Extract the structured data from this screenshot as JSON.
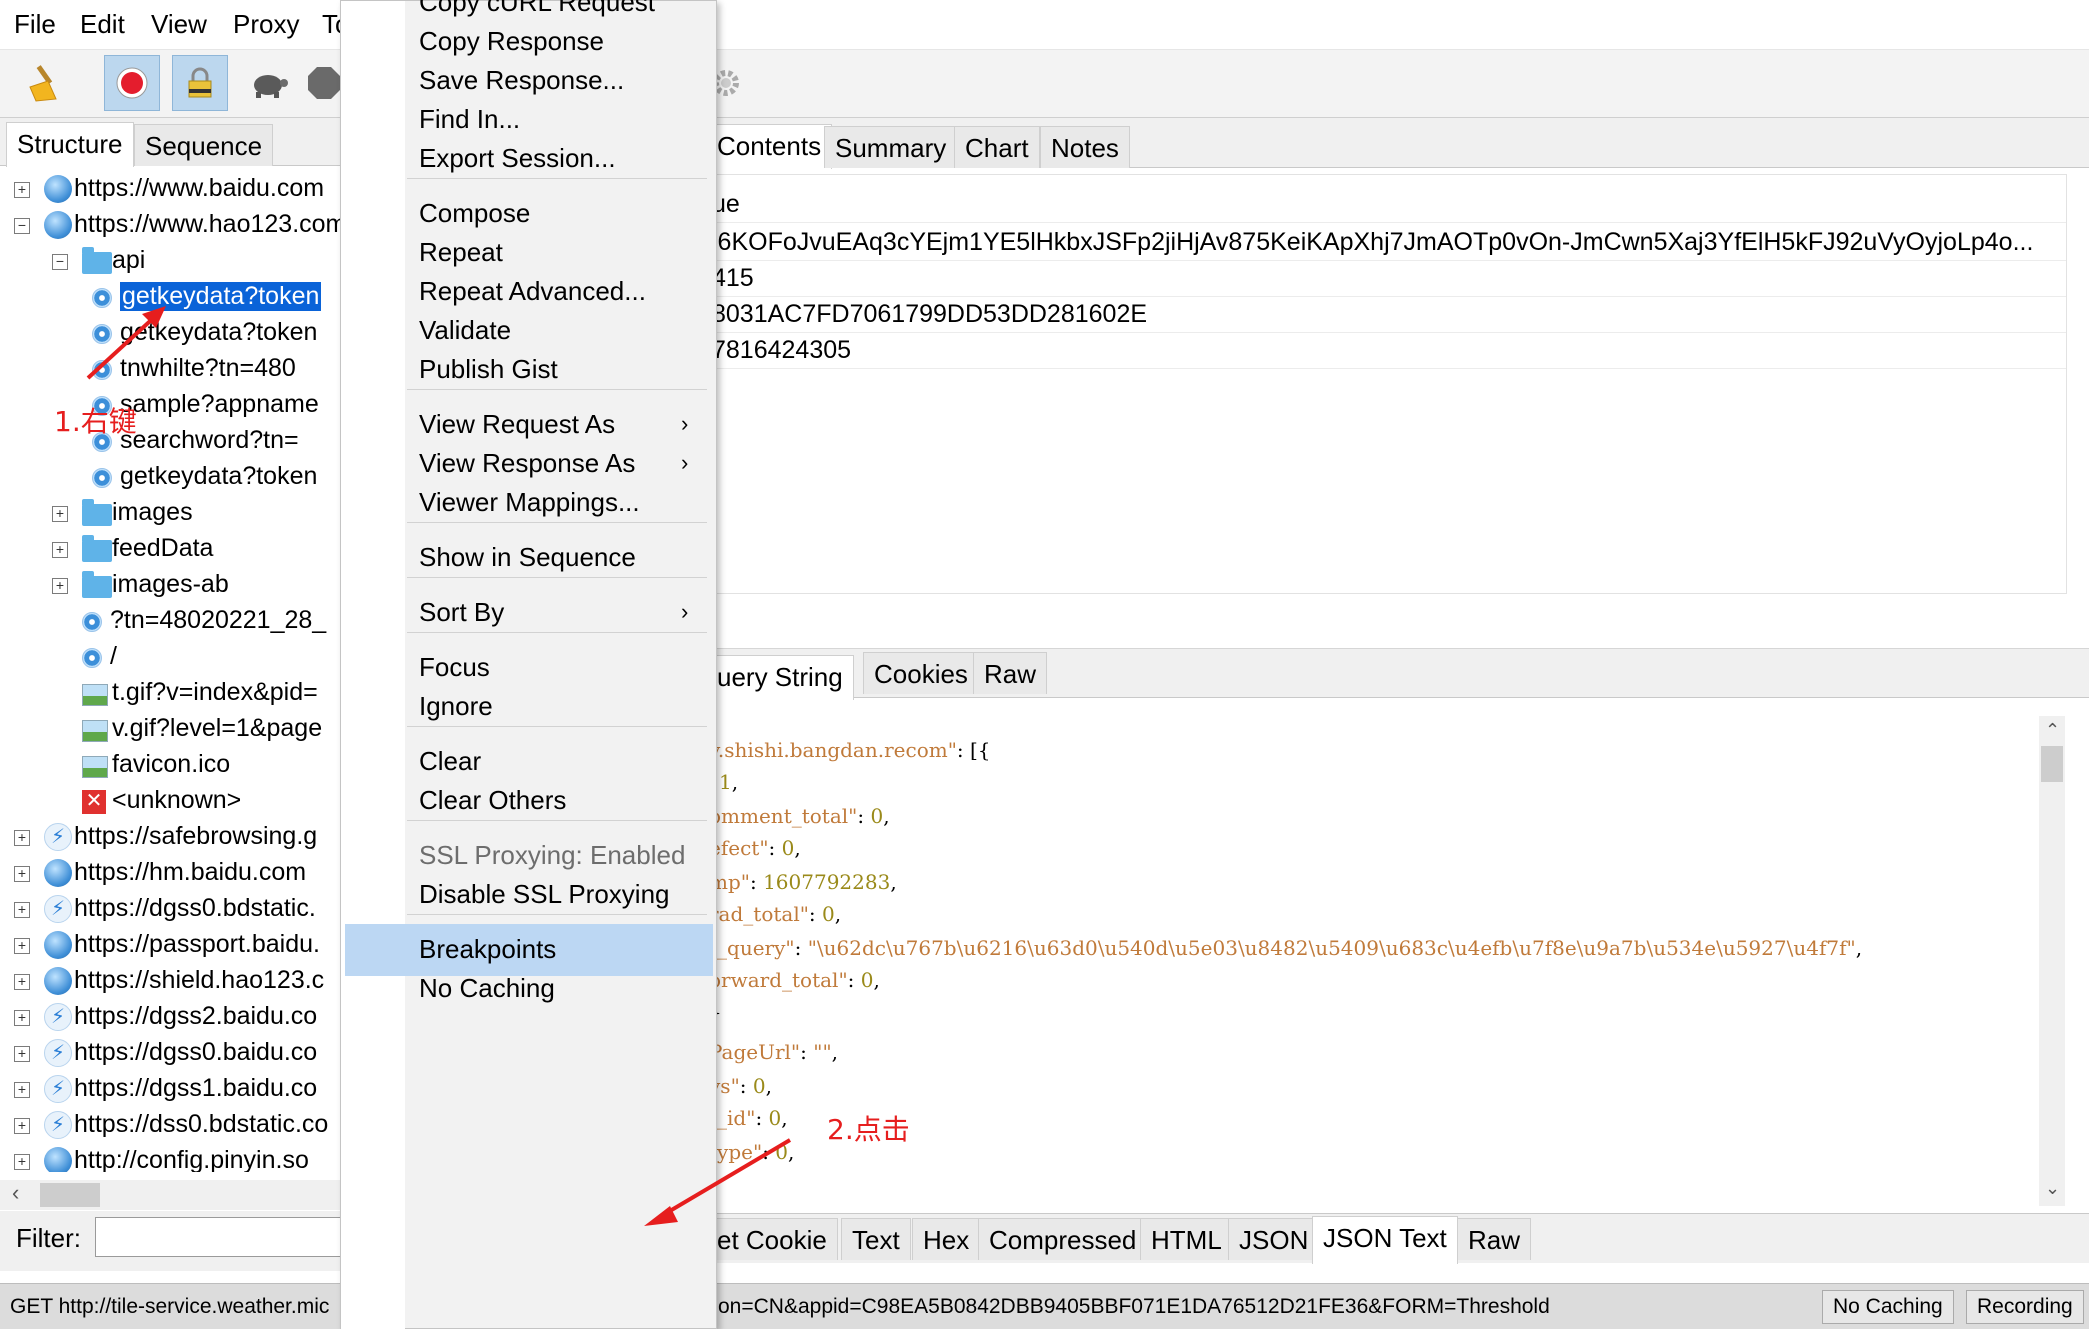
{
  "menubar": {
    "items": [
      "File",
      "Edit",
      "View",
      "Proxy",
      "To"
    ]
  },
  "toolbar": {
    "icons": [
      "broom-icon",
      "record-icon",
      "ssl-lock-icon",
      "turtle-icon",
      "stop-icon",
      "settings-gear-icon"
    ]
  },
  "left_tabs": [
    "Structure",
    "Sequence"
  ],
  "tree": [
    {
      "expander": "+",
      "icon": "globe",
      "label": "https://www.baidu.com",
      "indent": 0
    },
    {
      "expander": "−",
      "icon": "globe",
      "label": "https://www.hao123.com",
      "indent": 0
    },
    {
      "expander": "−",
      "icon": "folder",
      "label": "api",
      "indent": 1
    },
    {
      "expander": "",
      "icon": "req",
      "label": "getkeydata?token",
      "indent": 2,
      "selected": true
    },
    {
      "expander": "",
      "icon": "req",
      "label": "getkeydata?token",
      "indent": 2
    },
    {
      "expander": "",
      "icon": "req",
      "label": "tnwhilte?tn=480",
      "indent": 2
    },
    {
      "expander": "",
      "icon": "req",
      "label": "sample?appname",
      "indent": 2
    },
    {
      "expander": "",
      "icon": "req",
      "label": "searchword?tn=",
      "indent": 2
    },
    {
      "expander": "",
      "icon": "req",
      "label": "getkeydata?token",
      "indent": 2
    },
    {
      "expander": "+",
      "icon": "folder",
      "label": "images",
      "indent": 1
    },
    {
      "expander": "+",
      "icon": "folder",
      "label": "feedData",
      "indent": 1
    },
    {
      "expander": "+",
      "icon": "folder",
      "label": "images-ab",
      "indent": 1
    },
    {
      "expander": "",
      "icon": "req",
      "label": "?tn=48020221_28_",
      "indent": 1
    },
    {
      "expander": "",
      "icon": "req",
      "label": "/",
      "indent": 1
    },
    {
      "expander": "",
      "icon": "img",
      "label": "t.gif?v=index&pid=",
      "indent": 1
    },
    {
      "expander": "",
      "icon": "img",
      "label": "v.gif?level=1&page",
      "indent": 1
    },
    {
      "expander": "",
      "icon": "img",
      "label": "favicon.ico",
      "indent": 1
    },
    {
      "expander": "",
      "icon": "x",
      "label": "<unknown>",
      "indent": 1
    },
    {
      "expander": "+",
      "icon": "bolt",
      "label": "https://safebrowsing.g",
      "indent": 0
    },
    {
      "expander": "+",
      "icon": "globe",
      "label": "https://hm.baidu.com",
      "indent": 0
    },
    {
      "expander": "+",
      "icon": "bolt",
      "label": "https://dgss0.bdstatic.",
      "indent": 0
    },
    {
      "expander": "+",
      "icon": "globe",
      "label": "https://passport.baidu.",
      "indent": 0
    },
    {
      "expander": "+",
      "icon": "globe",
      "label": "https://shield.hao123.c",
      "indent": 0
    },
    {
      "expander": "+",
      "icon": "bolt",
      "label": "https://dgss2.baidu.co",
      "indent": 0
    },
    {
      "expander": "+",
      "icon": "bolt",
      "label": "https://dgss0.baidu.co",
      "indent": 0
    },
    {
      "expander": "+",
      "icon": "bolt",
      "label": "https://dgss1.baidu.co",
      "indent": 0
    },
    {
      "expander": "+",
      "icon": "bolt",
      "label": "https://dss0.bdstatic.co",
      "indent": 0
    },
    {
      "expander": "+",
      "icon": "globe",
      "label": "http://config.pinyin.so",
      "indent": 0
    }
  ],
  "filter": {
    "label": "Filter:",
    "value": ""
  },
  "right_top_tabs": [
    "Contents",
    "Summary",
    "Chart",
    "Notes"
  ],
  "kv_header": "ue",
  "kv_values": [
    "i6KOFoJvuEAq3cYEjm1YE5lHkbxJSFp2jiHjAv875KeiKApXhj7JmAOTp0vOn-JmCwn5Xaj3YfElH5kFJ92uVyOyjoLp4o...",
    "415",
    "8031AC7FD7061799DD53DD281602E",
    "7816424305"
  ],
  "mid_tabs": [
    "uery String",
    "Cookies",
    "Raw"
  ],
  "json_lines": [
    [
      {
        "c": "jk",
        "t": "v.shishi.bangdan.recom\""
      },
      {
        "c": "jp",
        "t": ": [{"
      }
    ],
    [
      {
        "c": "jn",
        "t": "1"
      },
      {
        "c": "jp",
        "t": ","
      }
    ],
    [
      {
        "c": "jk",
        "t": "omment_total\""
      },
      {
        "c": "jp",
        "t": ": "
      },
      {
        "c": "jn",
        "t": "0"
      },
      {
        "c": "jp",
        "t": ","
      }
    ],
    [
      {
        "c": "jk",
        "t": "efect\""
      },
      {
        "c": "jp",
        "t": ": "
      },
      {
        "c": "jn",
        "t": "0"
      },
      {
        "c": "jp",
        "t": ","
      }
    ],
    [
      {
        "c": "jk",
        "t": "mp\""
      },
      {
        "c": "jp",
        "t": ": "
      },
      {
        "c": "jn",
        "t": "1607792283"
      },
      {
        "c": "jp",
        "t": ","
      }
    ],
    [
      {
        "c": "jk",
        "t": "rad_total\""
      },
      {
        "c": "jp",
        "t": ": "
      },
      {
        "c": "jn",
        "t": "0"
      },
      {
        "c": "jp",
        "t": ","
      }
    ],
    [
      {
        "c": "jk",
        "t": "t_query\""
      },
      {
        "c": "jp",
        "t": ": "
      },
      {
        "c": "js",
        "t": "\"\\u62dc\\u767b\\u6216\\u63d0\\u540d\\u5e03\\u8482\\u5409\\u683c\\u4efb\\u7f8e\\u9a7b\\u534e\\u5927\\u4f7f\""
      },
      {
        "c": "jp",
        "t": ","
      }
    ],
    [
      {
        "c": "jk",
        "t": "orward_total\""
      },
      {
        "c": "jp",
        "t": ": "
      },
      {
        "c": "jn",
        "t": "0"
      },
      {
        "c": "jp",
        "t": ","
      }
    ],
    [
      {
        "c": "jp",
        "t": "}"
      }
    ],
    [
      {
        "c": "jk",
        "t": "PageUrl\""
      },
      {
        "c": "jp",
        "t": ": "
      },
      {
        "c": "js",
        "t": "\"\""
      },
      {
        "c": "jp",
        "t": ","
      }
    ],
    [
      {
        "c": "jk",
        "t": "ys\""
      },
      {
        "c": "jp",
        "t": ": "
      },
      {
        "c": "jn",
        "t": "0"
      },
      {
        "c": "jp",
        "t": ","
      }
    ],
    [
      {
        "c": "jk",
        "t": "t_id\""
      },
      {
        "c": "jp",
        "t": ": "
      },
      {
        "c": "jn",
        "t": "0"
      },
      {
        "c": "jp",
        "t": ","
      }
    ],
    [
      {
        "c": "jk",
        "t": "type\""
      },
      {
        "c": "jp",
        "t": ": "
      },
      {
        "c": "jn",
        "t": "0"
      },
      {
        "c": "jp",
        "t": ","
      }
    ]
  ],
  "bottom_tabs": [
    "et Cookie",
    "Text",
    "Hex",
    "Compressed",
    "HTML",
    "JSON",
    "JSON Text",
    "Raw"
  ],
  "status": {
    "left": "GET http://tile-service.weather.mic",
    "right": "on=CN&appid=C98EA5B0842DBB9405BBF071E1DA76512D21FE36&FORM=Threshold",
    "btn1": "No Caching",
    "btn2": "Recording"
  },
  "context_menu": [
    {
      "label": "Copy cURL Request",
      "type": "item"
    },
    {
      "label": "Copy Response",
      "type": "item"
    },
    {
      "label": "Save Response...",
      "type": "item"
    },
    {
      "label": "Find In...",
      "type": "item"
    },
    {
      "label": "Export Session...",
      "type": "item"
    },
    {
      "type": "sep"
    },
    {
      "label": "Compose",
      "type": "item"
    },
    {
      "label": "Repeat",
      "type": "item"
    },
    {
      "label": "Repeat Advanced...",
      "type": "item"
    },
    {
      "label": "Validate",
      "type": "item"
    },
    {
      "label": "Publish Gist",
      "type": "item"
    },
    {
      "type": "sep"
    },
    {
      "label": "View Request As",
      "type": "sub"
    },
    {
      "label": "View Response As",
      "type": "sub"
    },
    {
      "label": "Viewer Mappings...",
      "type": "item"
    },
    {
      "type": "sep"
    },
    {
      "label": "Show in Sequence",
      "type": "item"
    },
    {
      "type": "sep"
    },
    {
      "label": "Sort By",
      "type": "sub"
    },
    {
      "type": "sep"
    },
    {
      "label": "Focus",
      "type": "item"
    },
    {
      "label": "Ignore",
      "type": "item"
    },
    {
      "type": "sep"
    },
    {
      "label": "Clear",
      "type": "item"
    },
    {
      "label": "Clear Others",
      "type": "item"
    },
    {
      "type": "sep"
    },
    {
      "label": "SSL Proxying: Enabled",
      "type": "disabled"
    },
    {
      "label": "Disable SSL Proxying",
      "type": "item"
    },
    {
      "type": "sep"
    },
    {
      "label": "Breakpoints",
      "type": "highlight"
    },
    {
      "label": "No Caching",
      "type": "item"
    }
  ],
  "annotations": {
    "step1": "1.右键",
    "step2": "2.点击",
    "color": "#e61e1e"
  },
  "colors": {
    "selection": "#0a63d8",
    "menu_highlight": "#bcd7f3",
    "toolbar_active": "#bcd7ee"
  }
}
